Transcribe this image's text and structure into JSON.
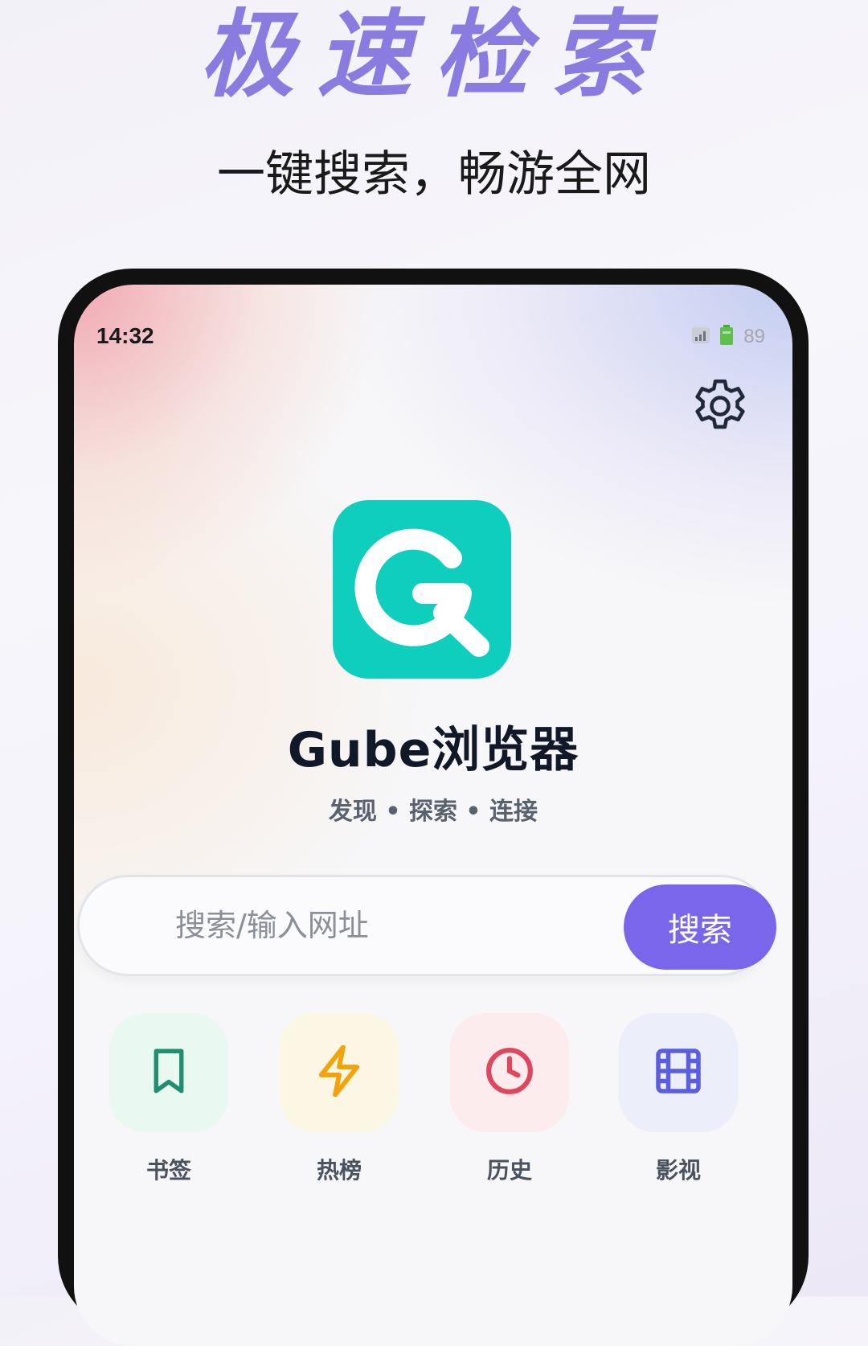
{
  "promo": {
    "title": "极速检索",
    "subtitle": "一键搜索，畅游全网"
  },
  "status_bar": {
    "time": "14:32",
    "battery": "89"
  },
  "app": {
    "name": "Gube浏览器",
    "tagline": "发现 • 探索 • 连接"
  },
  "search": {
    "placeholder": "搜索/输入网址",
    "button_label": "搜索"
  },
  "shortcuts": [
    {
      "label": "书签",
      "icon": "bookmark-icon",
      "color": "#1f8f6f",
      "bg": "#eaf8f2"
    },
    {
      "label": "热榜",
      "icon": "lightning-icon",
      "color": "#f2a20a",
      "bg": "#fcf6e4"
    },
    {
      "label": "历史",
      "icon": "clock-icon",
      "color": "#e0475f",
      "bg": "#fcecee"
    },
    {
      "label": "影视",
      "icon": "film-icon",
      "color": "#5a5fe0",
      "bg": "#eceef9"
    }
  ],
  "colors": {
    "accent": "#7a66ea",
    "logo": "#0ecfbe",
    "promo_title": "#8a7be0"
  }
}
